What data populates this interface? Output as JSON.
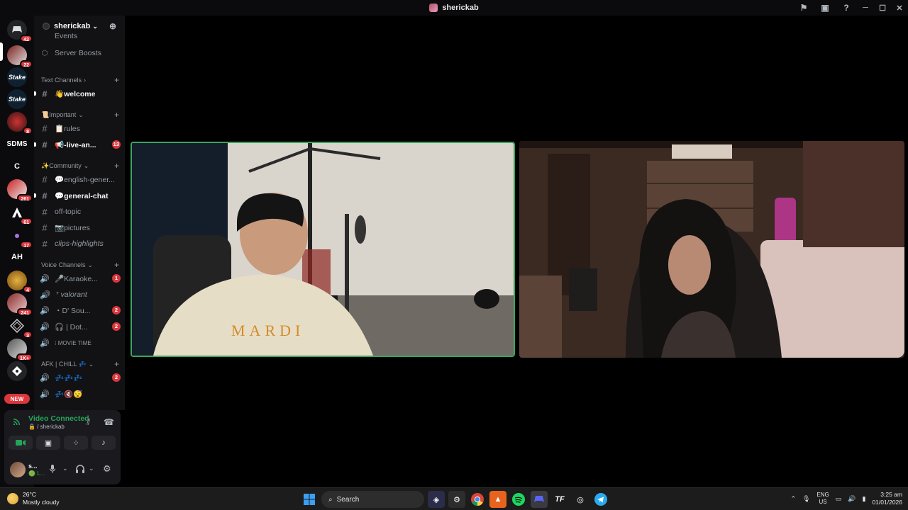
{
  "window": {
    "title": "sherickab"
  },
  "guild_rail": {
    "badges": [
      "42",
      "22",
      "8",
      "261",
      "61",
      "17",
      "4",
      "241",
      "3",
      "1K+"
    ],
    "labels": {
      "sdms": "SDMS",
      "c": "C",
      "ah": "AH",
      "stake": "Stake"
    },
    "new_label": "NEW"
  },
  "server": {
    "name": "sherickab",
    "events": "Events",
    "server_boosts": "Server Boosts",
    "categories": {
      "text": "Text Channels",
      "important": "📜Important",
      "community": "✨Community",
      "voice": "Voice Channels",
      "afk": "AFK | CHILL 💤"
    },
    "channels": {
      "welcome": "👋welcome",
      "rules": "📋rules",
      "live_announce": "📢-live-an...",
      "live_announce_badge": "13",
      "english_general": "💬english-gener...",
      "general_chat": "💬general-chat",
      "off_topic": "off-topic",
      "pictures": "📷pictures",
      "clips_highlights": "clips-highlights"
    },
    "voice_channels": {
      "karaoke": "🎤Karaoke...",
      "karaoke_badge": "1",
      "valorant": "⁺ valorant",
      "d_sou": "・D' Sou...",
      "d_sou_badge": "2",
      "dot": "🎧 | Dot...",
      "dot_badge": "2",
      "movie_time": "⁝ MOVIE TIME",
      "afk_1": "💤💤💤",
      "afk_1_badge": "2",
      "afk_2": "💤🔇😴"
    }
  },
  "voice_status": {
    "status": "Video Connected",
    "channel": "🔒 / sherickab"
  },
  "user": {
    "name": "s...",
    "status": "🟢 L..."
  },
  "taskbar": {
    "temperature": "26°C",
    "condition": "Mostly cloudy",
    "search_label": "Search",
    "lang_top": "ENG",
    "lang_bottom": "US",
    "time": "3:25 am",
    "date": "01/01/2026"
  },
  "colors": {
    "accent_green": "#23a55a",
    "badge_red": "#da373c",
    "speaking_border": "#3ba55d"
  }
}
